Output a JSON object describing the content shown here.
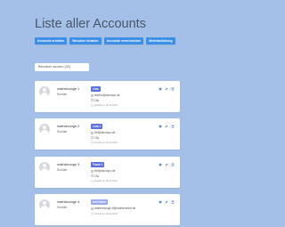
{
  "page": {
    "title": "Liste aller Accounts"
  },
  "actions": [
    {
      "label": "Accounts erstellen"
    },
    {
      "label": "Benutzer einladen"
    },
    {
      "label": "Accounts verschmelzen"
    },
    {
      "label": "Mehrfachleitung"
    }
  ],
  "search": {
    "label": "Benutzer suchen (31)"
  },
  "colors": {
    "background": "#a4c0e9",
    "button": "#3d8ee6",
    "badge_primary": "#5b6ee1",
    "badge_light": "#9aa8f0"
  },
  "accounts": [
    {
      "name": "mathelounge 1",
      "role": "Schüler",
      "badge": "Lina",
      "badge_color": "#5b6ee1",
      "email": "testfrei@abcmpo.de",
      "count": "15x",
      "created": "Erstellt am 30.11.2023"
    },
    {
      "name": "mathelounge 2",
      "role": "Schüler",
      "badge": "Lina 1",
      "badge_color": "#5b6ee1",
      "email": "frei@abcmpo.de",
      "count": "15x",
      "created": "Erstellt am 30.11.2023"
    },
    {
      "name": "mathelounge 3",
      "role": "Schüler",
      "badge": "Frank 2",
      "badge_color": "#5b6ee1",
      "email": "frei@abcmpo.de",
      "count": "15x",
      "created": "Erstellt am 30.11.2023"
    },
    {
      "name": "mathelounge 4",
      "role": "Schüler",
      "badge": "test Name",
      "badge_color": "#9aa8f0",
      "email": "mathelounge.4@mathecenter.de",
      "count": "",
      "created": "Erstellt am 30.11.2023"
    }
  ]
}
